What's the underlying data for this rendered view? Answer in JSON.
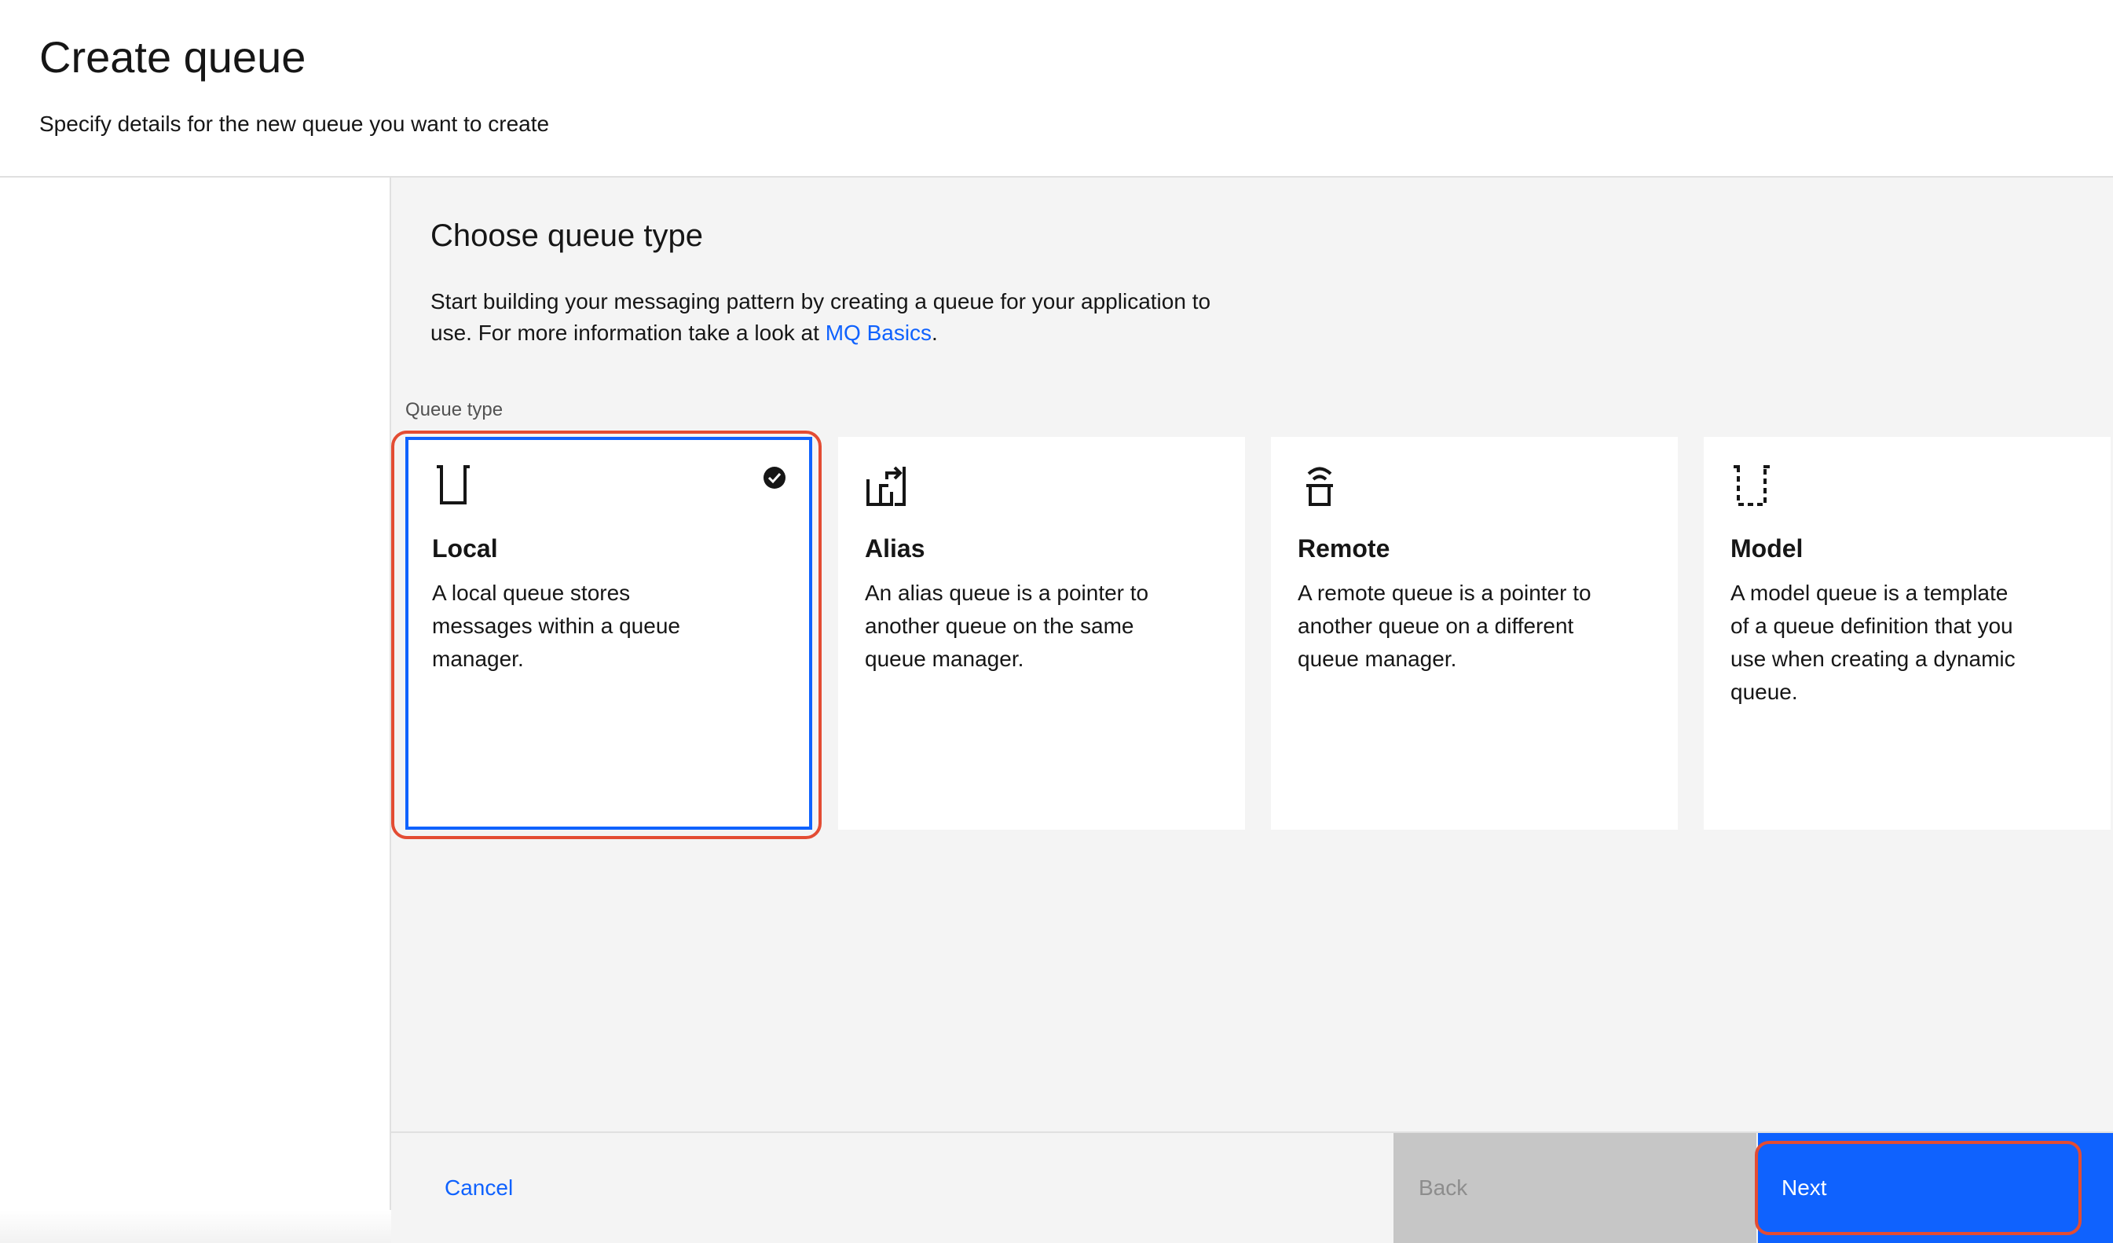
{
  "header": {
    "title": "Create queue",
    "subtitle": "Specify details for the new queue you want to create"
  },
  "main": {
    "section_title": "Choose queue type",
    "description_before": "Start building your messaging pattern by creating a queue for your application to use. For more information take a look at ",
    "description_link": "MQ Basics",
    "description_after": ".",
    "field_label": "Queue type",
    "tiles": [
      {
        "title": "Local",
        "description": "A local queue stores messages within a queue manager.",
        "icon": "local-queue-icon",
        "selected": true
      },
      {
        "title": "Alias",
        "description": "An alias queue is a pointer to another queue on the same queue manager.",
        "icon": "alias-queue-icon",
        "selected": false
      },
      {
        "title": "Remote",
        "description": "A remote queue is a pointer to another queue on a different queue manager.",
        "icon": "remote-queue-icon",
        "selected": false
      },
      {
        "title": "Model",
        "description": "A model queue is a template of a queue definition that you use when creating a dynamic queue.",
        "icon": "model-queue-icon",
        "selected": false
      }
    ]
  },
  "footer": {
    "cancel_label": "Cancel",
    "back_label": "Back",
    "next_label": "Next"
  },
  "colors": {
    "accent": "#0f62fe",
    "highlight": "#e34c33",
    "panel_background": "#f4f4f4",
    "disabled_button": "#c6c6c6"
  }
}
